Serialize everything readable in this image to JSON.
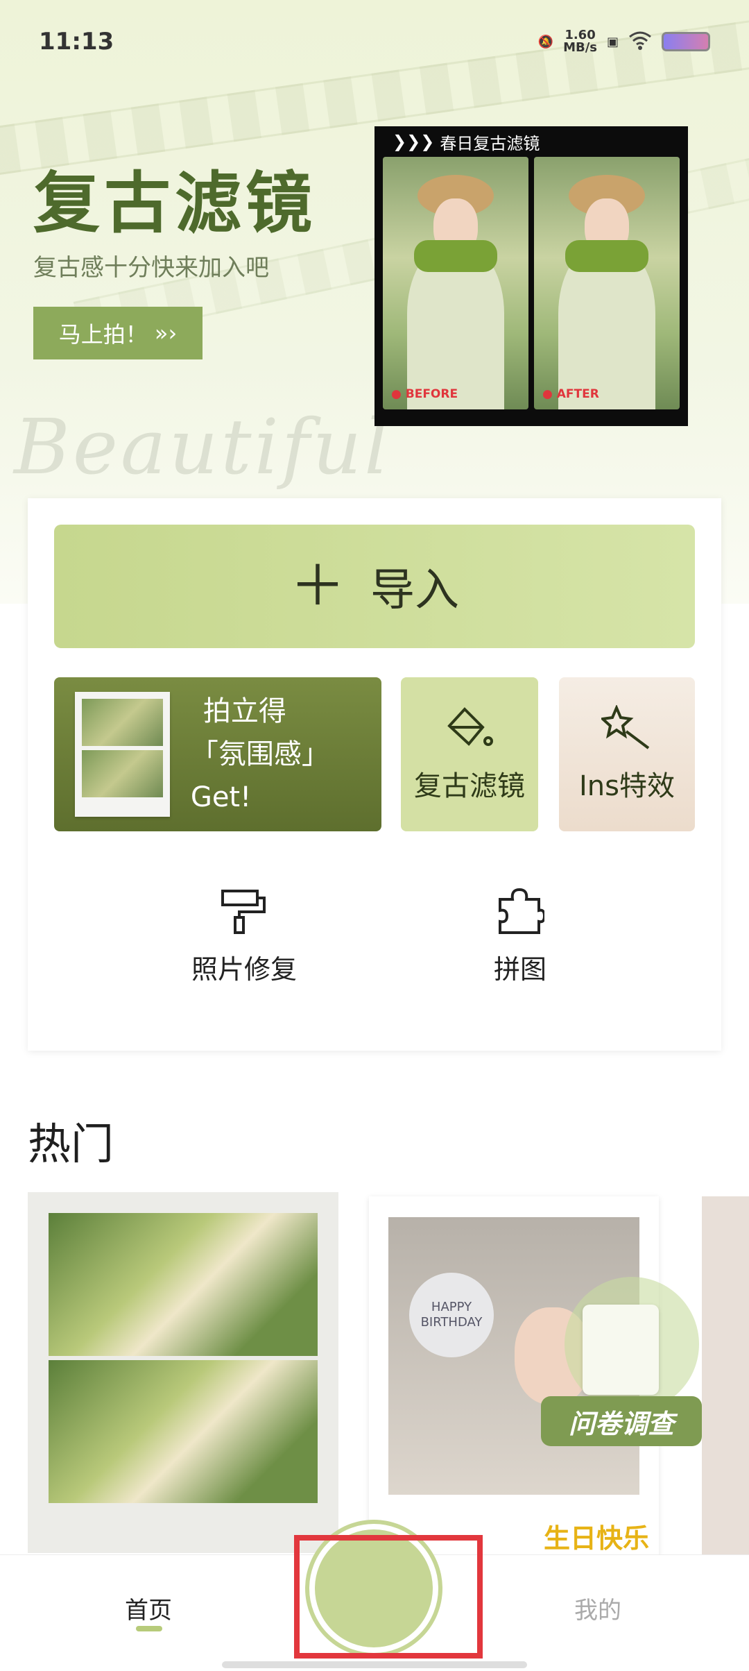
{
  "status_bar": {
    "time": "11:13",
    "speed": "1.60",
    "speed_unit": "MB/s"
  },
  "hero": {
    "title": "复古滤镜",
    "subtitle": "复古感十分快来加入吧",
    "button": "马上拍！",
    "watermark": "Beautiful",
    "preview": {
      "label": "春日复古滤镜",
      "before": "● BEFORE",
      "after": "● AFTER"
    }
  },
  "actions": {
    "import": "导入",
    "polaroid_line1": "拍立得",
    "polaroid_line2": "「氛围感」Get!",
    "vintage_filter": "复古滤镜",
    "ins_effect": "Ins特效",
    "photo_repair": "照片修复",
    "collage": "拼图"
  },
  "hot": {
    "title": "热门",
    "card2_balloon": "HAPPY BIRTHDAY",
    "card2_sign": "生日快乐",
    "survey": "问卷调查"
  },
  "nav": {
    "home": "首页",
    "mine": "我的"
  },
  "colors": {
    "accent": "#8daa5b",
    "highlight": "#e2373d"
  }
}
